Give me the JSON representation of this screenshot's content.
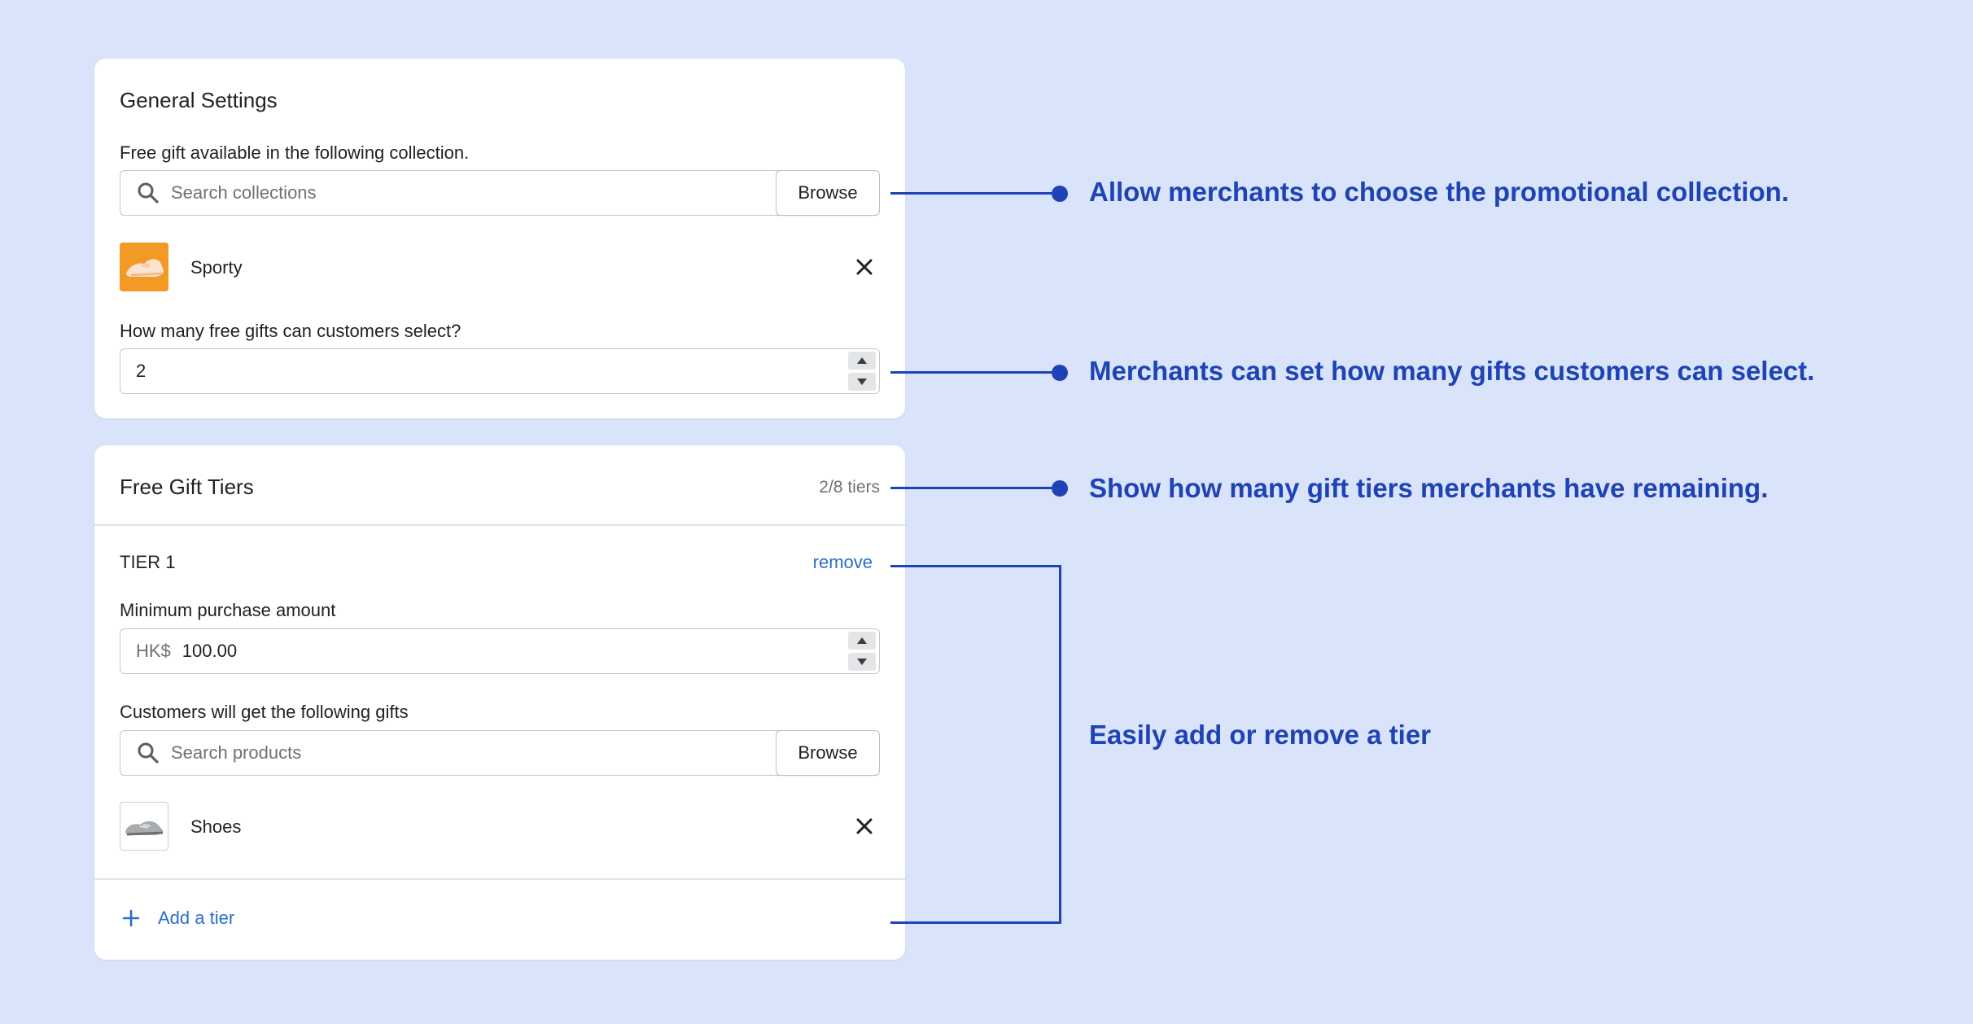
{
  "general": {
    "title": "General Settings",
    "collection_label": "Free gift available in the following collection.",
    "collection_search_placeholder": "Search collections",
    "browse_label": "Browse",
    "selected_collection": "Sporty",
    "gift_count_label": "How many free gifts can customers select?",
    "gift_count_value": "2"
  },
  "tiers": {
    "title": "Free Gift Tiers",
    "count_text": "2/8 tiers",
    "tier": {
      "name": "TIER 1",
      "remove_label": "remove",
      "min_purchase_label": "Minimum purchase amount",
      "currency_prefix": "HK$",
      "min_purchase_value": "100.00",
      "gifts_label": "Customers will get the following gifts",
      "product_search_placeholder": "Search products",
      "browse_label": "Browse",
      "selected_product": "Shoes"
    },
    "add_tier_label": "Add a tier"
  },
  "annotations": {
    "collection": "Allow merchants to choose the promotional collection.",
    "gift_count": "Merchants can set how many gifts customers can select.",
    "tiers_remaining": "Show how many gift tiers merchants have remaining.",
    "add_remove": "Easily add or remove a tier"
  },
  "colors": {
    "background": "#d9e4fb",
    "annotation": "#1f43b5",
    "link": "#2c6ecb"
  },
  "icons": {
    "search": "search-icon",
    "close": "close-icon",
    "plus": "plus-icon",
    "arrow_up": "arrow-up-icon",
    "arrow_down": "arrow-down-icon"
  }
}
